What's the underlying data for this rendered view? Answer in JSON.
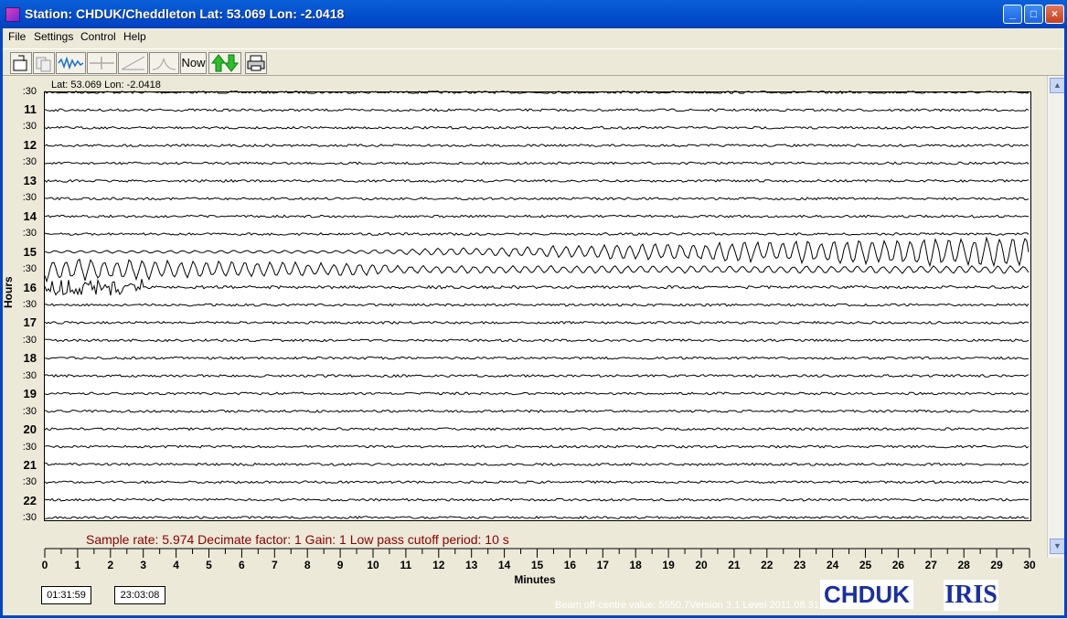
{
  "window": {
    "title": "Station: CHDUK/Cheddleton Lat: 53.069 Lon: -2.0418"
  },
  "menu": [
    "File",
    "Settings",
    "Control",
    "Help"
  ],
  "toolbar": {
    "now_label": "Now"
  },
  "plot": {
    "latlon": "Lat: 53.069 Lon: -2.0418",
    "ylabel": "Hours",
    "xlabel": "Minutes",
    "hour_labels": [
      "11",
      "12",
      "13",
      "14",
      "15",
      "16",
      "17",
      "18",
      "19",
      "20",
      "21",
      "22"
    ],
    "half_label": ":30",
    "x_ticks": [
      "0",
      "1",
      "2",
      "3",
      "4",
      "5",
      "6",
      "7",
      "8",
      "9",
      "10",
      "11",
      "12",
      "13",
      "14",
      "15",
      "16",
      "17",
      "18",
      "19",
      "20",
      "21",
      "22",
      "23",
      "24",
      "25",
      "26",
      "27",
      "28",
      "29",
      "30"
    ],
    "status": "Sample rate: 5.974  Decimate factor: 1  Gain: 1  Low pass cutoff period: 10 s"
  },
  "footer": {
    "time1": "01:31:59",
    "time2": "23:03:08",
    "beam": "Beam off-centre value: 5550.7Version 3.1 Level 2011.08.31",
    "logo1": "CHDUK",
    "logo2": "IRIS"
  },
  "colors": {
    "title_bar": "#0453cf",
    "status_text": "#8b0000",
    "logo_text": "#1a2fa0"
  }
}
